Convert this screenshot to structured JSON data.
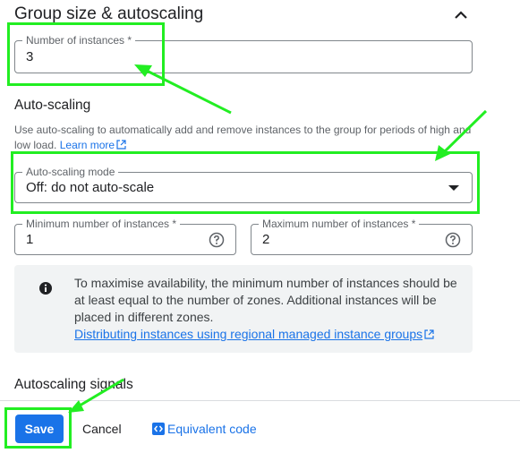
{
  "section": {
    "title": "Group size & autoscaling",
    "collapse_icon": "chevron-up-icon"
  },
  "instances": {
    "label": "Number of instances *",
    "value": "3"
  },
  "autoscaling": {
    "heading": "Auto-scaling",
    "description": "Use auto-scaling to automatically add and remove instances to the group for periods of high and low load.",
    "learn_more": "Learn more",
    "mode_label": "Auto-scaling mode",
    "mode_value": "Off: do not auto-scale",
    "min_label": "Minimum number of instances *",
    "min_value": "1",
    "max_label": "Maximum number of instances *",
    "max_value": "2"
  },
  "info": {
    "text": "To maximise availability, the minimum number of instances should be at least equal to the number of zones. Additional instances will be placed in different zones.",
    "link": "Distributing instances using regional managed instance groups"
  },
  "signals": {
    "heading": "Autoscaling signals"
  },
  "footer": {
    "save": "Save",
    "cancel": "Cancel",
    "equivalent_code": "Equivalent code"
  },
  "colors": {
    "accent": "#1a73e8",
    "annotation": "#22ee22",
    "info_bg": "#f1f3f4"
  }
}
